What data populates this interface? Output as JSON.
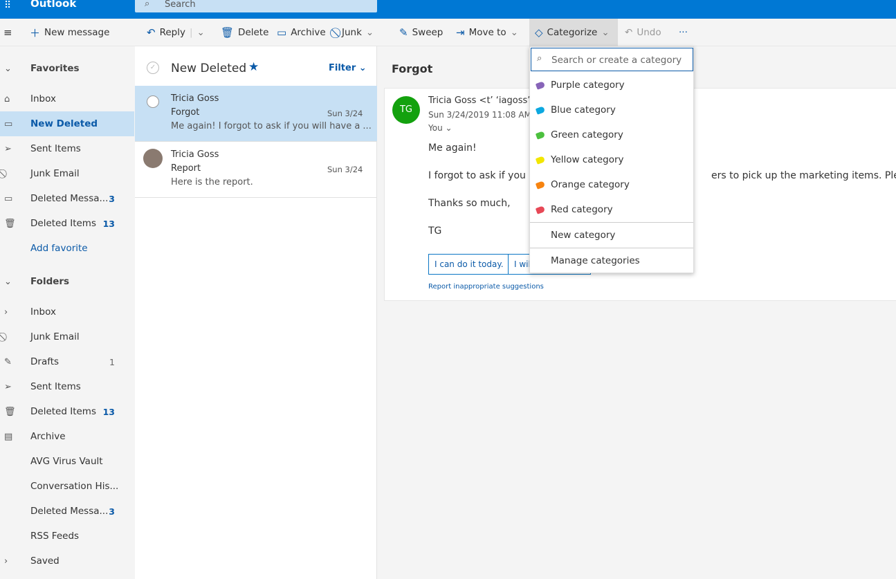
{
  "app": {
    "title": "Outlook",
    "search_placeholder": "Search"
  },
  "toolbar": {
    "new_message": "New message",
    "reply": "Reply",
    "delete": "Delete",
    "archive": "Archive",
    "junk": "Junk",
    "sweep": "Sweep",
    "move_to": "Move to",
    "categorize": "Categorize",
    "undo": "Undo",
    "more": "···"
  },
  "nav": {
    "favorites": "Favorites",
    "fav_items": [
      {
        "label": "Inbox",
        "icon": "inbox-icon",
        "count": ""
      },
      {
        "label": "New Deleted",
        "icon": "folder-icon",
        "count": ""
      },
      {
        "label": "Sent Items",
        "icon": "send-icon",
        "count": ""
      },
      {
        "label": "Junk Email",
        "icon": "block-icon",
        "count": ""
      },
      {
        "label": "Deleted Messa...",
        "icon": "folder-icon",
        "count": "3"
      },
      {
        "label": "Deleted Items",
        "icon": "trash-icon",
        "count": "13"
      }
    ],
    "add_favorite": "Add favorite",
    "folders": "Folders",
    "folder_items": [
      {
        "label": "Inbox",
        "icon": "chevron-right-icon",
        "count": ""
      },
      {
        "label": "Junk Email",
        "icon": "block-icon",
        "count": ""
      },
      {
        "label": "Drafts",
        "icon": "pencil-icon",
        "count": "1"
      },
      {
        "label": "Sent Items",
        "icon": "send-icon",
        "count": ""
      },
      {
        "label": "Deleted Items",
        "icon": "trash-icon",
        "count": "13"
      },
      {
        "label": "Archive",
        "icon": "archive-icon",
        "count": ""
      },
      {
        "label": "AVG Virus Vault",
        "icon": "",
        "count": ""
      },
      {
        "label": "Conversation His...",
        "icon": "",
        "count": ""
      },
      {
        "label": "Deleted Messa...",
        "icon": "",
        "count": "3"
      },
      {
        "label": "RSS Feeds",
        "icon": "",
        "count": ""
      },
      {
        "label": "Saved",
        "icon": "chevron-right-icon",
        "count": ""
      }
    ]
  },
  "list": {
    "title": "New Deleted",
    "filter": "Filter",
    "messages": [
      {
        "sender": "Tricia Goss",
        "subject": "Forgot",
        "date": "Sun 3/24",
        "preview": "Me again! I forgot to ask if you will have a ..."
      },
      {
        "sender": "Tricia Goss",
        "subject": "Report",
        "date": "Sun 3/24",
        "preview": "Here is the report."
      }
    ]
  },
  "reading": {
    "subject": "Forgot",
    "avatar_initials": "TG",
    "avatar_color": "#13a10e",
    "from": "Tricia Goss <t’ ‘iagoss’x",
    "datetime": "Sun 3/24/2019 11:08 AM",
    "to": "You",
    "body": [
      "Me again!",
      "I forgot to ask if you w",
      "ers to pick up the marketing items. Please let",
      "Thanks so much,",
      "TG"
    ],
    "suggestions": [
      "I can do it today.",
      "I will"
    ],
    "report": "Report inappropriate suggestions"
  },
  "category_menu": {
    "search_placeholder": "Search or create a category",
    "categories": [
      {
        "label": "Purple category",
        "color": "#8764b8"
      },
      {
        "label": "Blue category",
        "color": "#0ca8e0"
      },
      {
        "label": "Green category",
        "color": "#4cc03e"
      },
      {
        "label": "Yellow category",
        "color": "#f2e600"
      },
      {
        "label": "Orange category",
        "color": "#f7830f"
      },
      {
        "label": "Red category",
        "color": "#e74856"
      }
    ],
    "new_category": "New category",
    "manage_categories": "Manage categories"
  }
}
